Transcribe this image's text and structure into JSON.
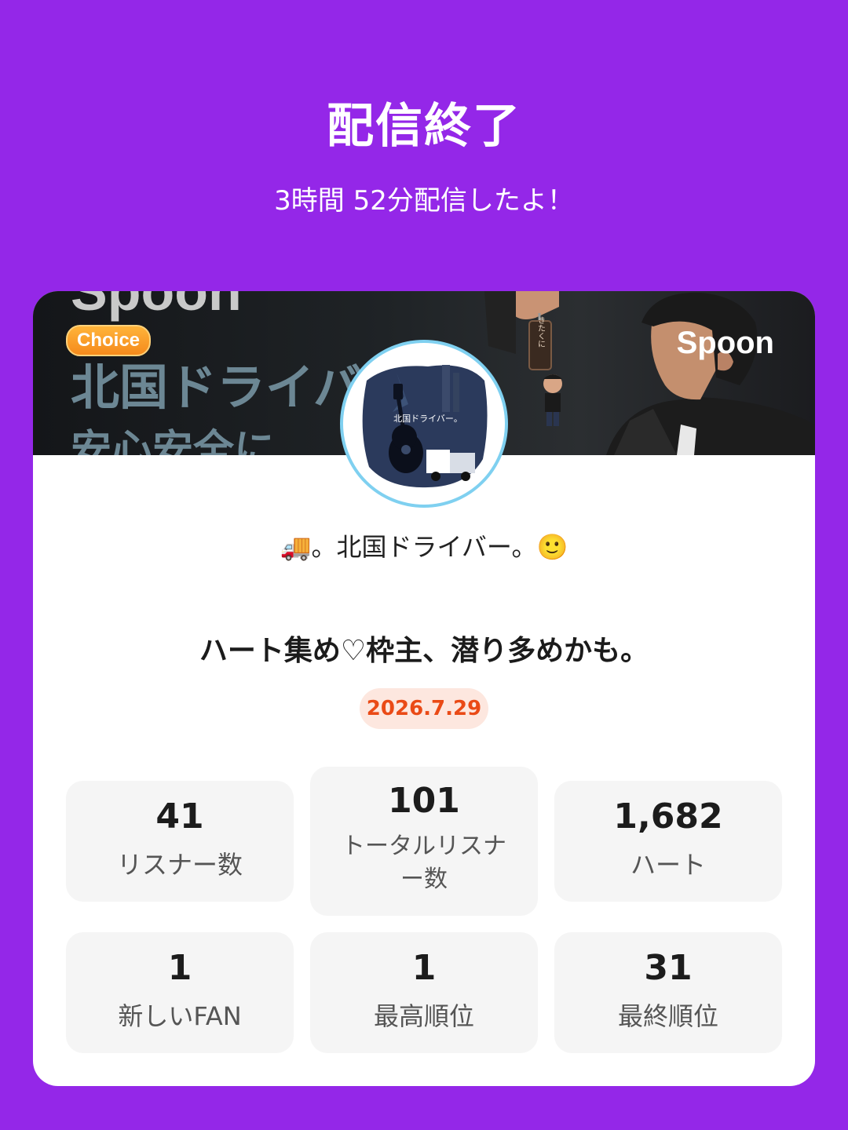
{
  "header": {
    "title": "配信終了",
    "duration_text": "3時間 52分配信したよ！"
  },
  "banner": {
    "bg_text_top": "Spoon",
    "bg_text_line1": "北国ドライバ",
    "bg_text_line2": "安心安全に",
    "choice_badge": "Choice",
    "brand_logo": "Spoon",
    "keychain_text": "きたくに"
  },
  "avatar": {
    "caption": "北国ドライバー。"
  },
  "profile": {
    "name": "🚚。北国ドライバー。🙂"
  },
  "stream": {
    "title": "ハート集め♡枠主、潜り多めかも。",
    "date": "2026.7.29"
  },
  "stats": [
    {
      "value": "41",
      "label": "リスナー数"
    },
    {
      "value": "101",
      "label": "トータルリスナー数"
    },
    {
      "value": "1,682",
      "label": "ハート"
    },
    {
      "value": "1",
      "label": "新しいFAN"
    },
    {
      "value": "1",
      "label": "最高順位"
    },
    {
      "value": "31",
      "label": "最終順位"
    }
  ],
  "colors": {
    "background": "#9427e8",
    "date_text": "#ea4a16",
    "date_bg": "#fde7df",
    "stat_bg": "#f5f5f5"
  }
}
